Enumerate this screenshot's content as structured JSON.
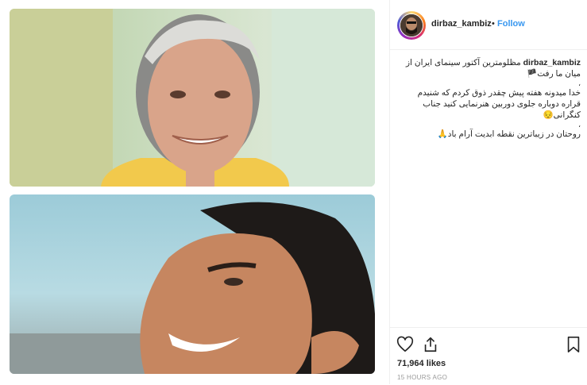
{
  "post": {
    "username": "dirbaz_kambiz",
    "separator": "•",
    "follow_label": "Follow"
  },
  "caption": {
    "username": "dirbaz_kambiz",
    "line1_text": "مظلومترین آکتور سینمای ایران از",
    "line2_text": "میان ما رفت",
    "line2_emoji": "🏴",
    "mark1": "،",
    "line3_text": "خدا میدونه هفته پیش چقدر ذوق کردم که شنیدم",
    "line4_text": "قراره دوباره جلوی دوربین هنرنمایی کنید جناب",
    "line5_text": "کنگرانی",
    "line5_emoji": "😔",
    "mark2": "،",
    "line6_text": "روحتان در زیباترین نقطه ابدیت آرام باد",
    "line6_emoji": "🙏"
  },
  "footer": {
    "likes": "71,964 likes",
    "time": "15 HOURS AGO"
  },
  "icons": [
    "heart-icon",
    "share-icon",
    "bookmark-icon"
  ],
  "colors": {
    "accent": "#3897f0",
    "text": "#262626",
    "muted": "#999999"
  }
}
